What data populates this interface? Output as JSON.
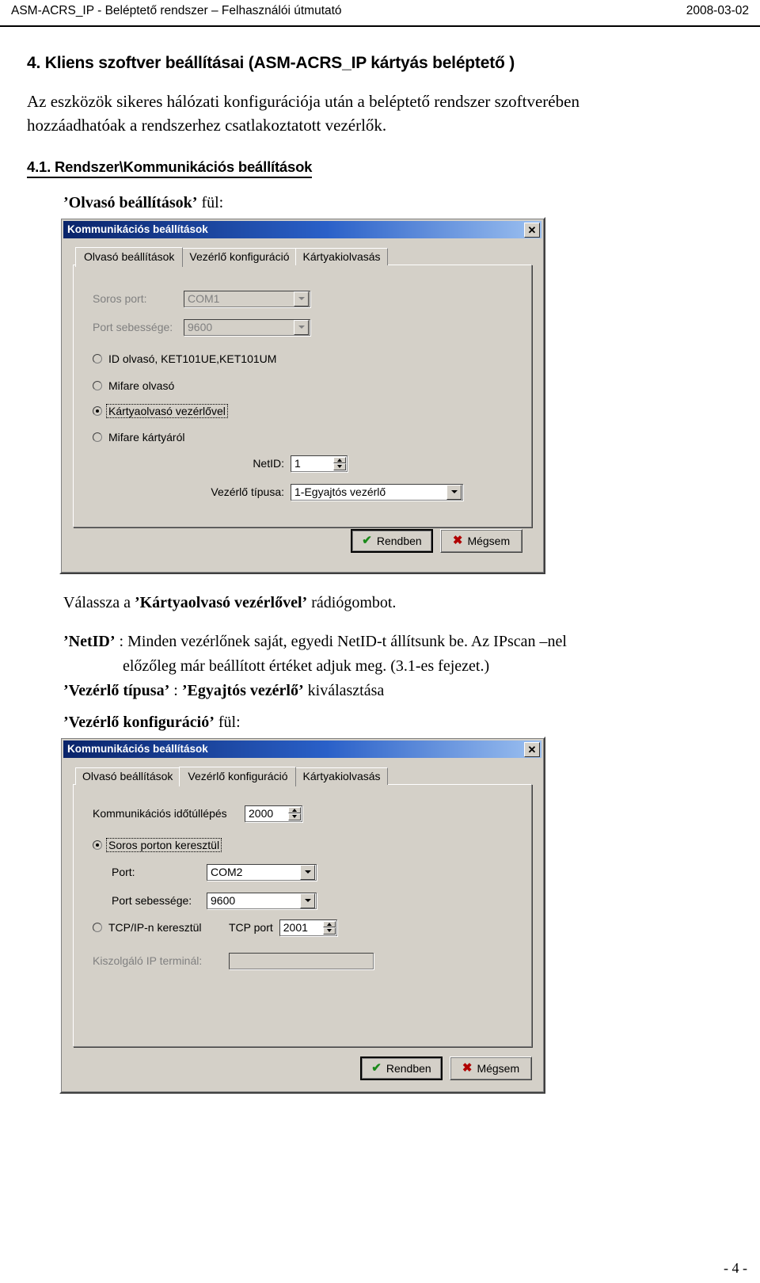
{
  "header": {
    "left": "ASM-ACRS_IP - Beléptető rendszer – Felhasználói útmutató",
    "right": "2008-03-02"
  },
  "footer": {
    "page": "- 4 -"
  },
  "document": {
    "section_title": "4. Kliens szoftver beállításai (ASM-ACRS_IP kártyás beléptető )",
    "intro_paragraph": "Az eszközök sikeres hálózati konfigurációja után a beléptető rendszer szoftverében hozzáadhatóak a rendszerhez csatlakoztatott vezérlők.",
    "subsection_title": "4.1. Rendszer\\Kommunikációs beállítások",
    "caption_reader_tab_quoted": "’Olvasó beállítások’",
    "caption_reader_tab_suffix": " fül:",
    "caption_controller_tab_quoted": "’Vezérlő konfiguráció’",
    "caption_controller_tab_suffix": " fül:",
    "notes": {
      "radio_note_prefix": "Válassza a ",
      "radio_note_bold": "’Kártyaolvasó vezérlővel’",
      "radio_note_suffix": " rádiógombot.",
      "netid_label": "’NetID’",
      "netid_sep": " : ",
      "netid_text_line1": "Minden vezérlőnek saját, egyedi NetID-t állítsunk be. Az IPscan –nel",
      "netid_text_line2": "előzőleg már beállított értéket adjuk meg. (3.1-es fejezet.)",
      "ctrltype_label": "’Vezérlő típusa’",
      "ctrltype_sep": " : ",
      "ctrltype_bold": "’Egyajtós vezérlő’",
      "ctrltype_suffix": " kiválasztása"
    }
  },
  "dialog1": {
    "title": "Kommunikációs beállítások",
    "close_label": "✕",
    "tabs": [
      {
        "label": "Olvasó beállítások",
        "active": true
      },
      {
        "label": "Vezérlő konfiguráció",
        "active": false
      },
      {
        "label": "Kártyakiolvasás",
        "active": false
      }
    ],
    "fields": {
      "serial_port_label": "Soros port:",
      "serial_port_value": "COM1",
      "port_speed_label": "Port sebessége:",
      "port_speed_value": "9600",
      "netid_label": "NetID:",
      "netid_value": "1",
      "controller_type_label": "Vezérlő típusa:",
      "controller_type_value": "1-Egyajtós vezérlő"
    },
    "radios": [
      {
        "label": "ID olvasó, KET101UE,KET101UM",
        "checked": false,
        "focused": false
      },
      {
        "label": "Mifare olvasó",
        "checked": false,
        "focused": false
      },
      {
        "label": "Kártyaolvasó vezérlővel",
        "checked": true,
        "focused": true
      },
      {
        "label": "Mifare kártyáról",
        "checked": false,
        "focused": false
      }
    ],
    "buttons": {
      "ok_label": "Rendben",
      "ok_icon": "check-icon",
      "cancel_label": "Mégsem",
      "cancel_icon": "cross-icon"
    }
  },
  "dialog2": {
    "title": "Kommunikációs beállítások",
    "close_label": "✕",
    "tabs": [
      {
        "label": "Olvasó beállítások",
        "active": false
      },
      {
        "label": "Vezérlő konfiguráció",
        "active": true
      },
      {
        "label": "Kártyakiolvasás",
        "active": false
      }
    ],
    "fields": {
      "timeout_label": "Kommunikációs időtúllépés",
      "timeout_value": "2000",
      "port_label": "Port:",
      "port_value": "COM2",
      "port_speed_label": "Port sebessége:",
      "port_speed_value": "9600",
      "tcp_port_label": "TCP port",
      "tcp_port_value": "2001",
      "server_ip_label": "Kiszolgáló IP terminál:",
      "server_ip_value": ""
    },
    "radios": [
      {
        "label": "Soros porton keresztül",
        "checked": true,
        "focused": true
      },
      {
        "label": "TCP/IP-n keresztül",
        "checked": false,
        "focused": false
      }
    ],
    "buttons": {
      "ok_label": "Rendben",
      "ok_icon": "check-icon",
      "cancel_label": "Mégsem",
      "cancel_icon": "cross-icon"
    }
  },
  "colors": {
    "dialog_face": "#d4d0c8",
    "titlebar_start": "#0a246a",
    "titlebar_end": "#9cc0f0",
    "ok_green": "#1a8a1a",
    "cancel_red": "#b00000"
  }
}
